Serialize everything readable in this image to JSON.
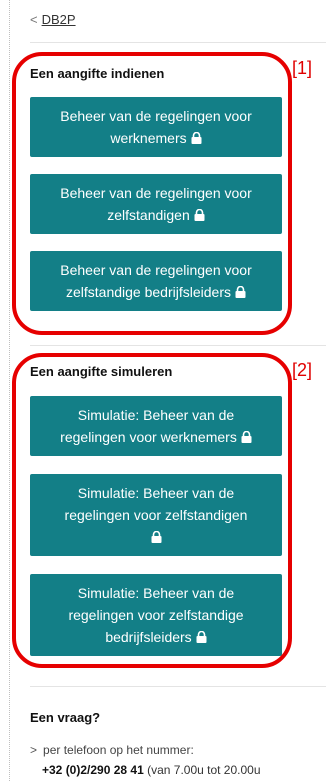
{
  "breadcrumb": {
    "chevron": "<",
    "label": "DB2P"
  },
  "section1": {
    "title": "Een aangifte indienen",
    "marker": "[1]",
    "buttons": [
      {
        "line1": "Beheer van de regelingen voor",
        "line2": "werknemers"
      },
      {
        "line1": "Beheer van de regelingen voor",
        "line2": "zelfstandigen"
      },
      {
        "line1": "Beheer van de regelingen voor",
        "line2": "zelfstandige bedrijfsleiders"
      }
    ]
  },
  "section2": {
    "title": "Een aangifte simuleren",
    "marker": "[2]",
    "buttons": [
      {
        "line1": "Simulatie: Beheer van de",
        "line2": "regelingen voor werknemers"
      },
      {
        "line1": "Simulatie: Beheer van de",
        "line2": "regelingen voor zelfstandigen",
        "line3": ""
      },
      {
        "line1": "Simulatie: Beheer van de",
        "line2": "regelingen voor zelfstandige",
        "line3": "bedrijfsleiders"
      }
    ]
  },
  "contact": {
    "title": "Een vraag?",
    "chevron": ">",
    "line1": "per telefoon op het nummer:",
    "phone": "+32 (0)2/290 28 41",
    "hours": "(van 7.00u tot 20.00u"
  },
  "colors": {
    "button": "#137f87",
    "highlight": "#e60000"
  },
  "icons": {
    "lock": "lock-icon"
  }
}
